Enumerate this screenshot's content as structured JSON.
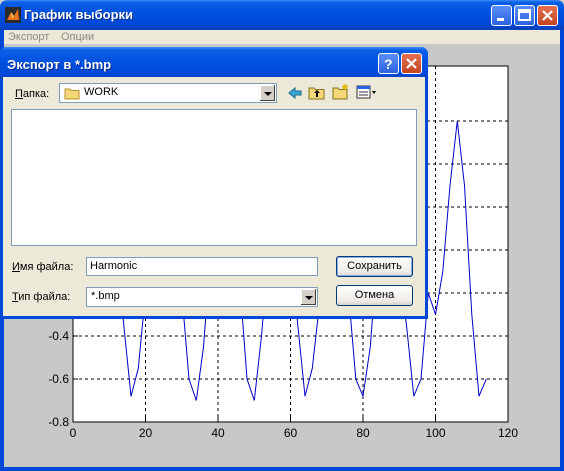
{
  "window": {
    "title": "График выборки",
    "menu": [
      "Экспорт",
      "Опции"
    ]
  },
  "plot": {
    "x_ticks": [
      "0",
      "20",
      "40",
      "60",
      "80",
      "100",
      "120"
    ],
    "y_ticks": [
      "-0.4",
      "-0.6",
      "-0.8"
    ]
  },
  "dialog": {
    "title": "Экспорт в *.bmp",
    "folder_label_ul": "П",
    "folder_label_rest": "апка:",
    "folder_value": "WORK",
    "filename_label_ul": "И",
    "filename_label_rest": "мя файла:",
    "filename_value": "Harmonic",
    "filetype_label_ul": "Т",
    "filetype_label_rest": "ип файла:",
    "filetype_value": "*.bmp",
    "save_label": "Сохранить",
    "cancel_label": "Отмена",
    "icons": [
      "back-icon",
      "up-folder-icon",
      "new-folder-icon",
      "view-menu-icon",
      "help-icon",
      "close-icon"
    ]
  },
  "colors": {
    "xp_blue": "#0048D8",
    "plot_line": "#0000C8",
    "figure_bg": "#C8C8C8"
  },
  "chart_data": {
    "type": "line",
    "xlim": [
      0,
      120
    ],
    "ylim_visible": [
      -0.8,
      -0.3
    ],
    "grid": true,
    "series": [
      {
        "x": [
          0,
          2,
          4,
          6,
          8,
          10,
          12,
          14,
          16,
          18,
          20,
          22,
          24,
          26,
          28,
          30,
          32,
          34,
          36,
          38,
          40,
          42,
          44,
          46,
          48,
          50,
          52,
          54,
          56,
          58,
          60,
          62,
          64,
          66,
          68,
          70,
          72,
          74,
          76,
          78,
          80,
          82,
          84,
          86,
          88,
          90,
          92,
          94,
          96,
          98,
          100,
          102,
          104,
          106,
          108,
          110,
          112,
          114
        ],
        "y": [
          0,
          0,
          0,
          0,
          0,
          0,
          0,
          -0.35,
          -0.68,
          -0.55,
          -0.2,
          0,
          0,
          0,
          0,
          -0.2,
          -0.6,
          -0.7,
          -0.45,
          0,
          0,
          0,
          0,
          -0.15,
          -0.6,
          -0.7,
          -0.4,
          0,
          0,
          0,
          0,
          -0.35,
          -0.68,
          -0.55,
          -0.25,
          0,
          0,
          0,
          -0.2,
          -0.6,
          -0.68,
          -0.45,
          0,
          0,
          0,
          -0.1,
          -0.35,
          -0.68,
          -0.6,
          -0.2,
          -0.3,
          -0.1,
          0.3,
          0.6,
          0.3,
          -0.3,
          -0.68,
          -0.6
        ]
      }
    ]
  }
}
